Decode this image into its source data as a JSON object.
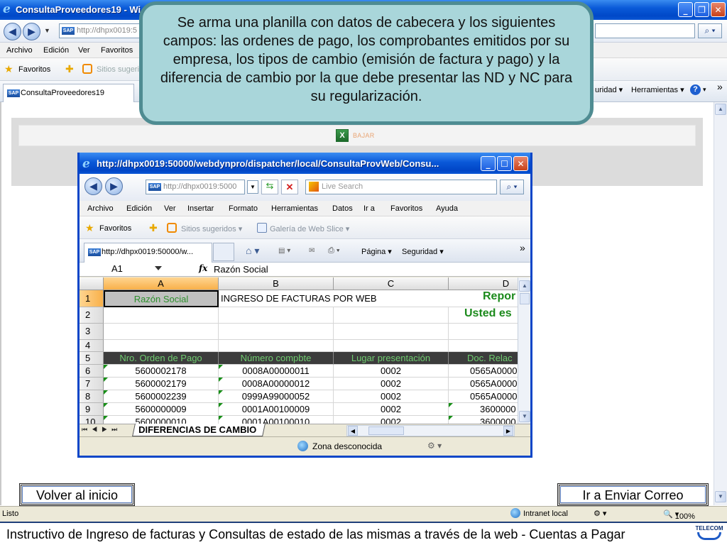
{
  "window": {
    "title": "ConsultaProveedores19 - Wi",
    "icon": "ie-icon",
    "controls": [
      "_",
      "❐",
      "✕"
    ]
  },
  "nav": {
    "address": "http://dhpx0019:5",
    "search_icon": "magnifier-icon"
  },
  "menu": [
    "Archivo",
    "Edición",
    "Ver",
    "Favoritos"
  ],
  "favorites": {
    "label": "Favoritos",
    "suggested": "Sitios sugeri"
  },
  "tab": {
    "label": "ConsultaProveedores19"
  },
  "toolbar": {
    "seguridad": "uridad ▾",
    "herramientas": "Herramientas ▾",
    "more": "»"
  },
  "download": {
    "label": "BAJAR",
    "icon": "excel-icon"
  },
  "callout": {
    "text": "Se arma una planilla con datos de cabecera y los siguientes campos: las ordenes de pago, los comprobantes emitidos por su empresa, los tipos de cambio (emisión de factura y pago) y la diferencia de cambio por la que debe presentar las ND y NC para su regularización."
  },
  "popup": {
    "title": "http://dhpx0019:50000/webdynpro/dispatcher/local/ConsultaProvWeb/Consu...",
    "address": "http://dhpx0019:5000",
    "search_placeholder": "Live Search",
    "menu": [
      "Archivo",
      "Edición",
      "Ver",
      "Insertar",
      "Formato",
      "Herramientas",
      "Datos",
      "Ir a",
      "Favoritos",
      "Ayuda"
    ],
    "favorites": "Favoritos",
    "suggested": "Sitios sugeridos ▾",
    "webslice": "Galería de Web Slice ▾",
    "tab": "http://dhpx0019:50000/w...",
    "pagina": "Página ▾",
    "seguridad": "Seguridad ▾",
    "more": "»",
    "status_zone": "Zona desconocida"
  },
  "sheet": {
    "namebox": "A1",
    "fx": "fx",
    "formula": "Razón Social",
    "columns": [
      "A",
      "B",
      "C",
      "D"
    ],
    "rows": [
      "1",
      "2",
      "3",
      "4",
      "5",
      "6",
      "7",
      "8",
      "9",
      "10"
    ],
    "r1": [
      "Razón Social",
      "INGRESO DE FACTURAS POR WEB",
      "",
      "Repor"
    ],
    "r2": [
      "",
      "",
      "",
      "Usted es"
    ],
    "headers": [
      "Nro. Orden de Pago",
      "Número compbte",
      "Lugar presentación",
      "Doc. Relac"
    ],
    "data": [
      [
        "5600002178",
        "0008A00000011",
        "0002",
        "0565A0000"
      ],
      [
        "5600002179",
        "0008A00000012",
        "0002",
        "0565A0000"
      ],
      [
        "5600002239",
        "0999A99000052",
        "0002",
        "0565A0000"
      ],
      [
        "5600000009",
        "0001A00100009",
        "0002",
        "3600000"
      ],
      [
        "5600000010",
        "0001A00100010",
        "0002",
        "3600000"
      ]
    ],
    "tab": "DIFERENCIAS DE CAMBIO"
  },
  "buttons": {
    "back": "Volver al inicio",
    "mail": "Ir  a Enviar Correo"
  },
  "status": {
    "left": "Listo",
    "zone": "Intranet local",
    "zoom": "100%"
  },
  "footer": {
    "text": "Instructivo de Ingreso de facturas y Consultas de estado de las mismas a través de la web    -    Cuentas a Pagar",
    "logo": "TELECOM"
  }
}
